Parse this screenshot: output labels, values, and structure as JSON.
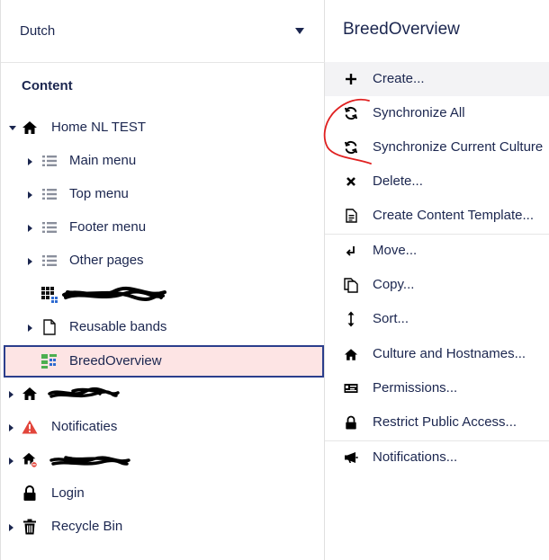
{
  "language_selector": {
    "value": "Dutch"
  },
  "tree": {
    "section_title": "Content",
    "nodes": [
      {
        "label": "Home NL TEST",
        "icon": "home-icon"
      },
      {
        "label": "Main menu",
        "icon": "list-icon"
      },
      {
        "label": "Top menu",
        "icon": "list-icon"
      },
      {
        "label": "Footer menu",
        "icon": "list-icon"
      },
      {
        "label": "Other pages",
        "icon": "list-icon"
      },
      {
        "label": "",
        "icon": "grid-icon"
      },
      {
        "label": "Reusable bands",
        "icon": "document-icon"
      },
      {
        "label": "BreedOverview",
        "icon": "dashboard-icon"
      },
      {
        "label": "",
        "icon": "home-icon"
      },
      {
        "label": "Notificaties",
        "icon": "warning-icon"
      },
      {
        "label": "",
        "icon": "home-blocked-icon"
      },
      {
        "label": "Login",
        "icon": "lock-icon"
      },
      {
        "label": "Recycle Bin",
        "icon": "trash-icon"
      }
    ]
  },
  "actions_panel": {
    "title": "BreedOverview",
    "items": [
      {
        "label": "Create...",
        "icon": "plus-icon"
      },
      {
        "label": "Synchronize All",
        "icon": "sync-icon"
      },
      {
        "label": "Synchronize Current Culture",
        "icon": "sync-icon"
      },
      {
        "label": "Delete...",
        "icon": "close-icon"
      },
      {
        "label": "Create Content Template...",
        "icon": "template-icon"
      },
      {
        "label": "Move...",
        "icon": "move-icon"
      },
      {
        "label": "Copy...",
        "icon": "copy-icon"
      },
      {
        "label": "Sort...",
        "icon": "sort-icon"
      },
      {
        "label": "Culture and Hostnames...",
        "icon": "home-icon"
      },
      {
        "label": "Permissions...",
        "icon": "permissions-icon"
      },
      {
        "label": "Restrict Public Access...",
        "icon": "lock-icon"
      },
      {
        "label": "Notifications...",
        "icon": "megaphone-icon"
      }
    ]
  },
  "colors": {
    "text": "#1b264f",
    "selected_bg": "#fde4e4",
    "selected_border": "#2b3e8c",
    "annotation": "#e02020",
    "warning": "#e2453b"
  }
}
